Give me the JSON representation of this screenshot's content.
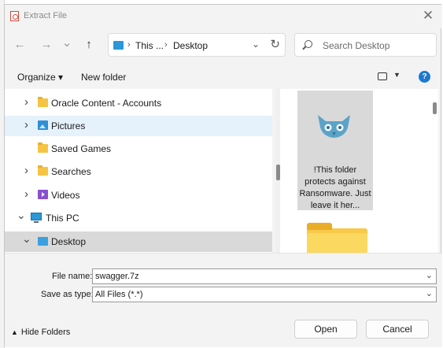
{
  "window": {
    "title": "Extract File",
    "close_glyph": "✕"
  },
  "toolbar": {
    "back_glyph": "←",
    "forward_glyph": "→",
    "recent_glyph": "⌄",
    "up_glyph": "↑",
    "address": {
      "segment1": "This ...",
      "segment2": "Desktop",
      "sep": "›",
      "dropdown_glyph": "⌄",
      "refresh_glyph": "↻"
    },
    "search_placeholder": "Search Desktop"
  },
  "commandbar": {
    "organize_label": "Organize ▾",
    "new_folder_label": "New folder",
    "view_dropdown_glyph": "▼",
    "help_glyph": "?"
  },
  "nav_tree": [
    {
      "label": "Oracle Content - Accounts",
      "icon": "folder-icon",
      "expandable": true
    },
    {
      "label": "Pictures",
      "icon": "pictures-icon",
      "expandable": true,
      "state": "hover"
    },
    {
      "label": "Saved Games",
      "icon": "folder-icon",
      "expandable": false
    },
    {
      "label": "Searches",
      "icon": "folder-icon",
      "expandable": true
    },
    {
      "label": "Videos",
      "icon": "videos-icon",
      "expandable": true
    },
    {
      "label": "This PC",
      "icon": "pc-icon",
      "expanded": true
    },
    {
      "label": "Desktop",
      "icon": "desktop-icon",
      "expanded": true,
      "state": "selected"
    }
  ],
  "files": [
    {
      "name": "!This folder protects against Ransomware. Just leave it her...",
      "thumbnail": "owl-logo-icon",
      "state": "selected"
    },
    {
      "name": "",
      "thumbnail": "folder-icon"
    }
  ],
  "form": {
    "file_name_label": "File name:",
    "file_name_value": "swagger.7z",
    "save_as_type_label": "Save as type:",
    "save_as_type_value": "All Files (*.*)",
    "dropdown_glyph": "⌄"
  },
  "footer": {
    "hide_folders_label": "Hide Folders",
    "hide_folders_caret": "▲",
    "open_label": "Open",
    "cancel_label": "Cancel"
  },
  "colors": {
    "accent": "#1b79d4",
    "selection_light": "#e5f1fb",
    "selection_grey": "#d9d9d9",
    "owl": "#5ba3c8"
  }
}
